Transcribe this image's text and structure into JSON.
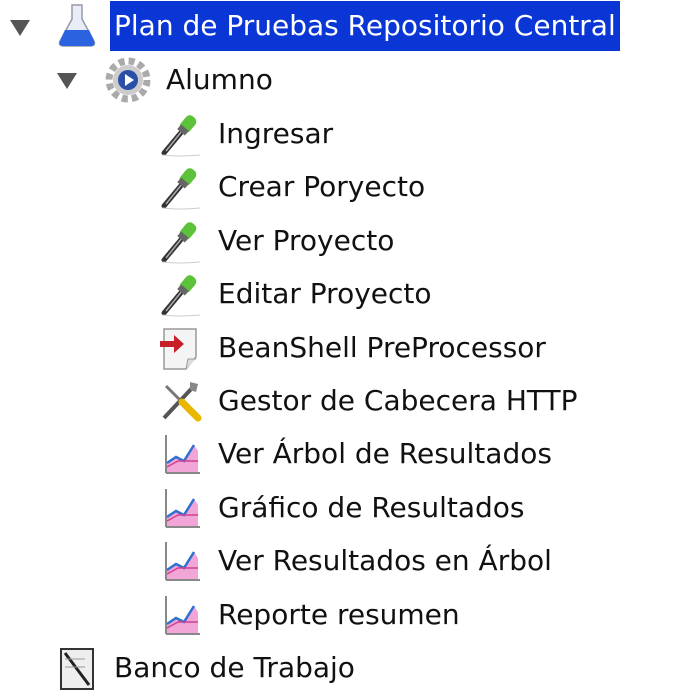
{
  "tree": {
    "root": {
      "label": "Plan de Pruebas Repositorio Central",
      "icon": "flask-icon",
      "expanded": true,
      "selected": true
    },
    "group": {
      "label": "Alumno",
      "icon": "gear-icon",
      "expanded": true
    },
    "children": [
      {
        "label": "Ingresar",
        "icon": "pipette-icon"
      },
      {
        "label": "Crear Poryecto",
        "icon": "pipette-icon"
      },
      {
        "label": "Ver Proyecto",
        "icon": "pipette-icon"
      },
      {
        "label": "Editar Proyecto",
        "icon": "pipette-icon"
      },
      {
        "label": "BeanShell PreProcessor",
        "icon": "preprocessor-icon"
      },
      {
        "label": "Gestor de Cabecera HTTP",
        "icon": "tools-icon"
      },
      {
        "label": "Ver Árbol de Resultados",
        "icon": "graph-icon"
      },
      {
        "label": "Gráfico de Resultados",
        "icon": "graph-icon"
      },
      {
        "label": "Ver Resultados en Árbol",
        "icon": "graph-icon"
      },
      {
        "label": "Reporte resumen",
        "icon": "graph-icon"
      }
    ],
    "workbench": {
      "label": "Banco de Trabajo",
      "icon": "workbench-icon"
    }
  },
  "colors": {
    "selection": "#0b36d6"
  }
}
